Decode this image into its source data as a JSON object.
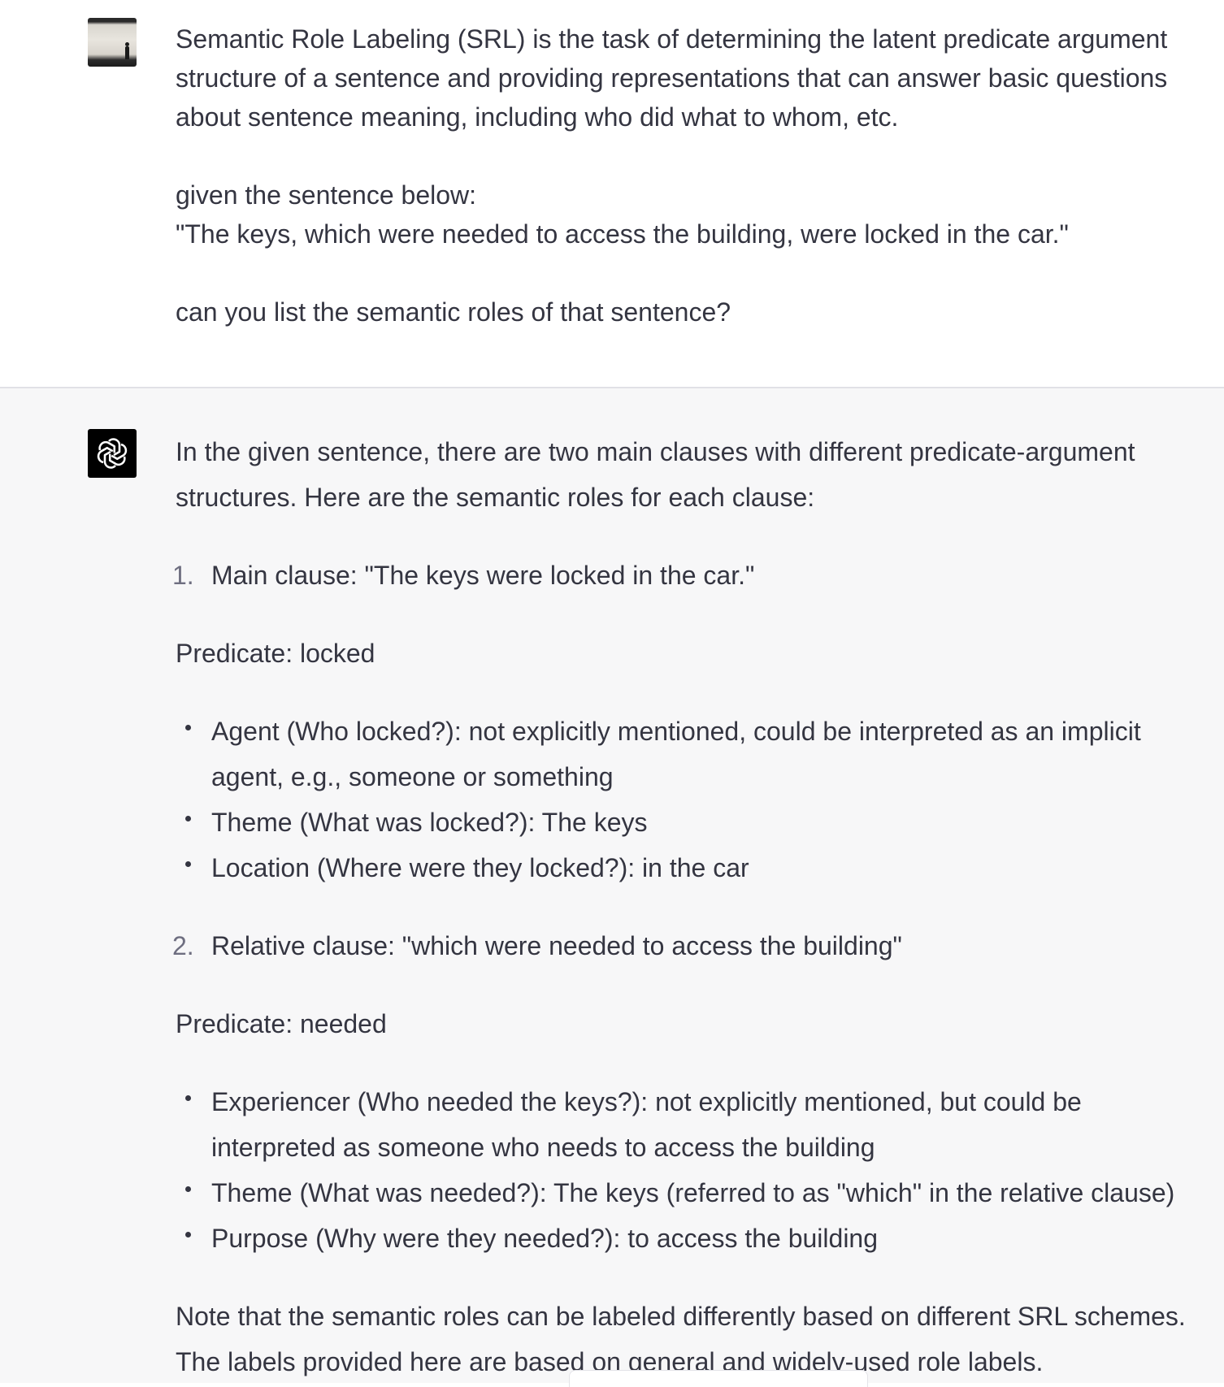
{
  "user_message": {
    "lines": [
      "Semantic Role Labeling (SRL) is the task of determining the latent predicate argument",
      "structure of a sentence and providing representations that can answer basic questions",
      "about sentence meaning, including who did what to whom, etc.",
      "given the sentence below:",
      "\"The keys, which were needed to access the building, were locked in the car.\"",
      "can you list the semantic roles of that sentence?"
    ]
  },
  "assistant_message": {
    "intro": [
      "In the given sentence, there are two main clauses with different predicate-argument",
      "structures. Here are the semantic roles for each clause:"
    ],
    "clauses": [
      {
        "number": "1.",
        "title": "Main clause: \"The keys were locked in the car.\"",
        "predicate": "Predicate: locked",
        "roles": [
          "Agent (Who locked?): not explicitly mentioned, could be interpreted as an implicit",
          "agent, e.g., someone or something",
          "Theme (What was locked?): The keys",
          "Location (Where were they locked?): in the car"
        ]
      },
      {
        "number": "2.",
        "title": "Relative clause: \"which were needed to access the building\"",
        "predicate": "Predicate: needed",
        "roles": [
          "Experiencer (Who needed the keys?): not explicitly mentioned, but could be",
          "interpreted as someone who needs to access the building",
          "Theme (What was needed?): The keys (referred to as \"which\" in the relative clause)",
          "Purpose (Why were they needed?): to access the building"
        ]
      }
    ],
    "note": [
      "Note that the semantic roles can be labeled differently based on different SRL schemes.",
      "The labels provided here are based on general and widely-used role labels."
    ]
  },
  "colors": {
    "text": "#343541",
    "assistant_bg": "#f7f7f8",
    "user_bg": "#ffffff",
    "list_marker": "#6e6e80"
  },
  "icons": {
    "user_avatar": "user-avatar-photo",
    "assistant_avatar": "openai-logo-icon"
  }
}
